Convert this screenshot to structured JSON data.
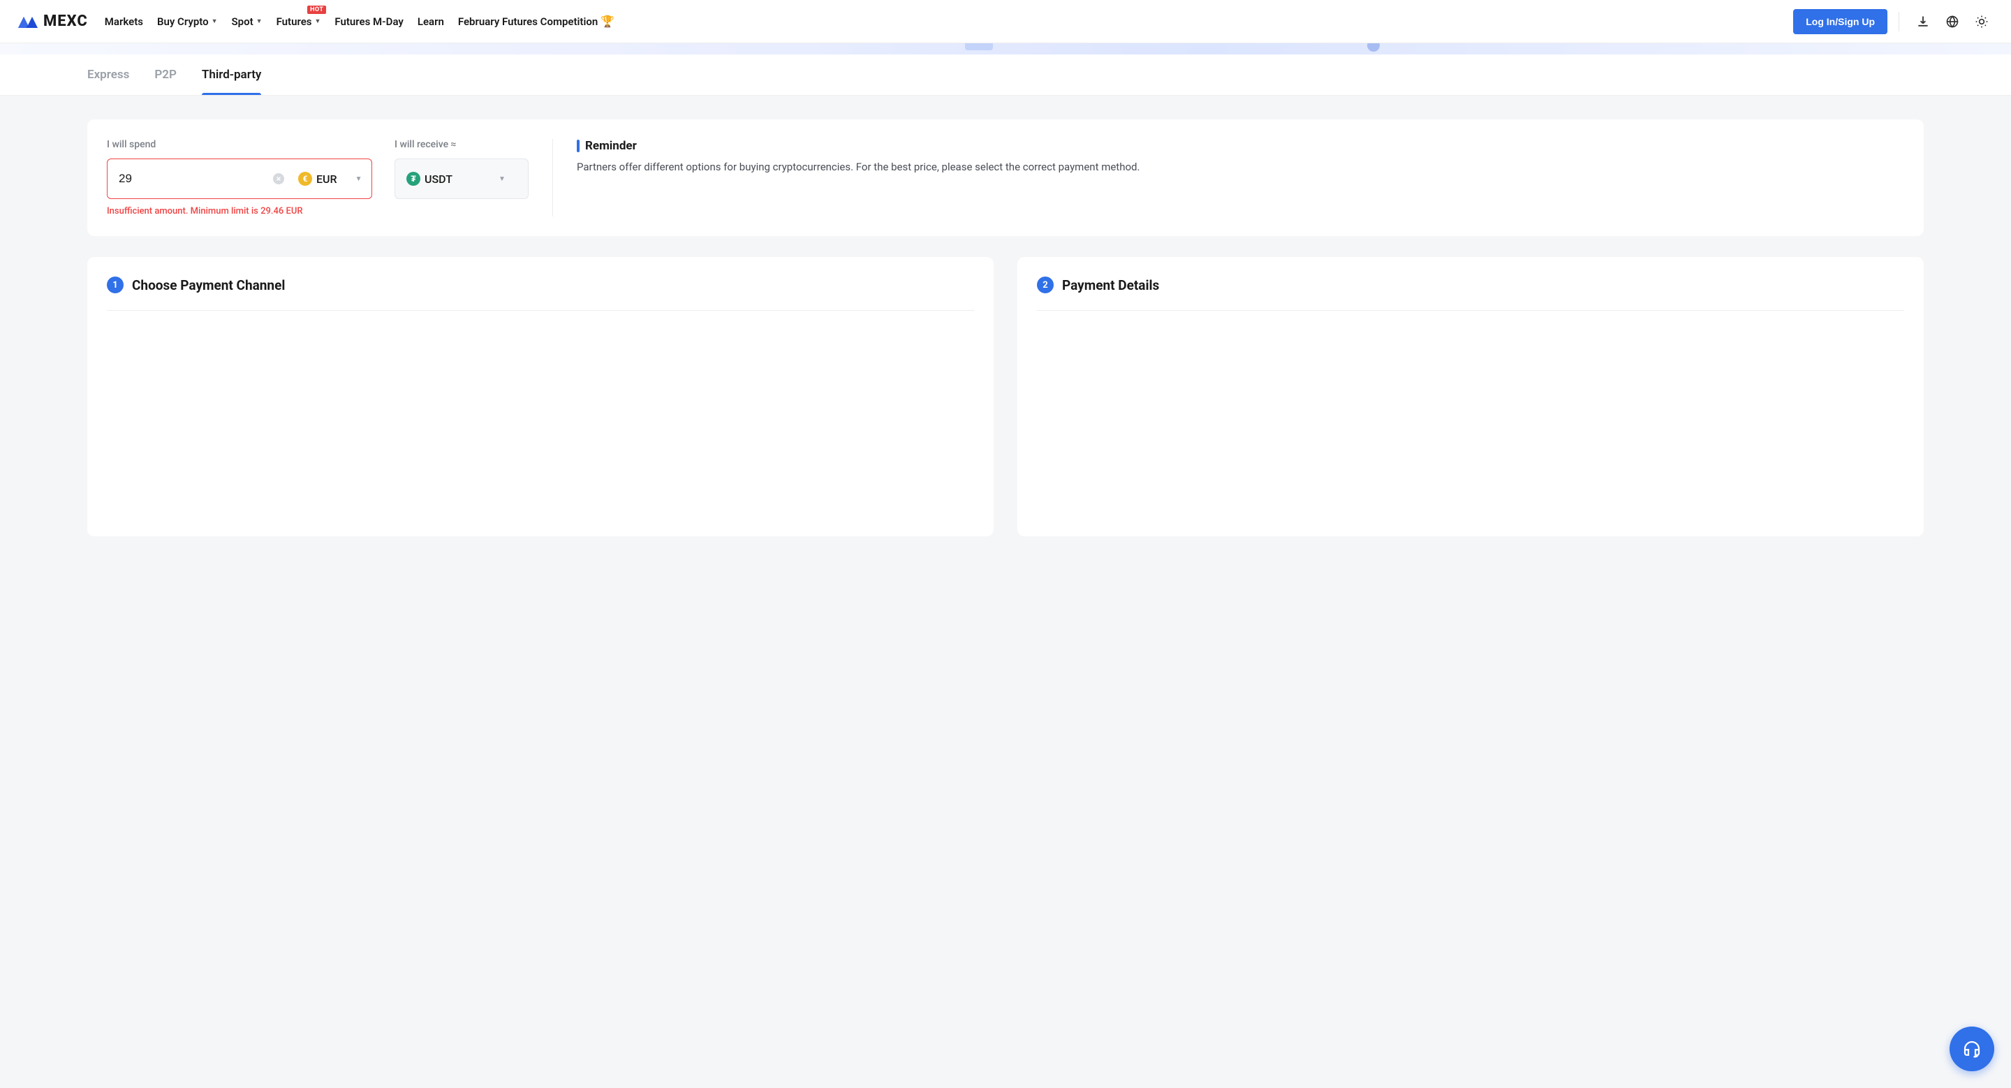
{
  "header": {
    "logo_text": "MEXC",
    "nav": [
      {
        "label": "Markets",
        "dropdown": false
      },
      {
        "label": "Buy Crypto",
        "dropdown": true
      },
      {
        "label": "Spot",
        "dropdown": true
      },
      {
        "label": "Futures",
        "dropdown": true,
        "badge": "HOT"
      },
      {
        "label": "Futures M-Day",
        "dropdown": false
      },
      {
        "label": "Learn",
        "dropdown": false
      },
      {
        "label": "February Futures Competition",
        "dropdown": false,
        "trophy": true
      }
    ],
    "login_label": "Log In/Sign Up"
  },
  "sub_tabs": [
    {
      "label": "Express",
      "active": false
    },
    {
      "label": "P2P",
      "active": false
    },
    {
      "label": "Third-party",
      "active": true
    }
  ],
  "exchange": {
    "spend_label": "I will spend",
    "receive_label": "I will receive ≈",
    "spend_value": "29",
    "spend_currency": "EUR",
    "receive_currency": "USDT",
    "error_msg": "Insufficient amount. Minimum limit is 29.46 EUR"
  },
  "reminder": {
    "title": "Reminder",
    "text": "Partners offer different options for buying cryptocurrencies. For the best price, please select the correct payment method."
  },
  "steps": {
    "choose": {
      "num": "1",
      "title": "Choose Payment Channel"
    },
    "details": {
      "num": "2",
      "title": "Payment Details"
    }
  }
}
